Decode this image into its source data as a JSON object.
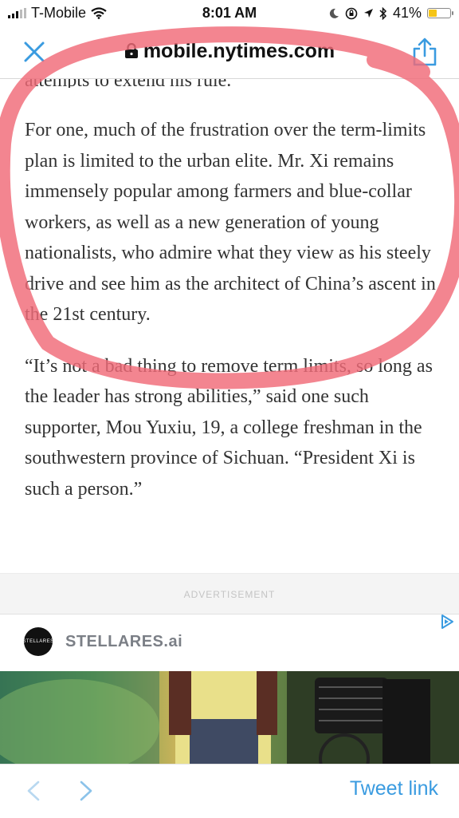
{
  "status_bar": {
    "carrier": "T-Mobile",
    "time": "8:01 AM",
    "battery_percent": "41%",
    "battery_level": 0.41
  },
  "header": {
    "url": "mobile.nytimes.com"
  },
  "article": {
    "cut_line": "attempts to extend his rule.",
    "paragraphs": [
      "For one, much of the frustration over the term-limits plan is limited to the urban elite. Mr. Xi remains immensely popular among farmers and blue-collar workers, as well as a new generation of young nationalists, who admire what they view as his steely drive and see him as the architect of China’s ascent in the 21st century.",
      "“It’s not a bad thing to remove term limits, so long as the leader has strong abilities,” said one such supporter, Mou Yuxiu, 19, a college freshman in the southwestern province of Sichuan. “President Xi is such a person.”"
    ]
  },
  "ad": {
    "label": "ADVERTISEMENT",
    "sponsor_logo_text": "STELLARES",
    "sponsor_name": "STELLARES.ai"
  },
  "bottom_bar": {
    "tweet_link": "Tweet link"
  },
  "colors": {
    "accent_blue": "#3a9be0",
    "annotation_red": "#f06a78",
    "battery_yellow": "#f5c518"
  },
  "icons": [
    "signal-icon",
    "wifi-icon",
    "moon-icon",
    "lock-rotation-icon",
    "location-icon",
    "bluetooth-icon",
    "battery-icon",
    "close-icon",
    "lock-icon",
    "share-icon",
    "adchoices-icon",
    "back-icon",
    "forward-icon"
  ]
}
